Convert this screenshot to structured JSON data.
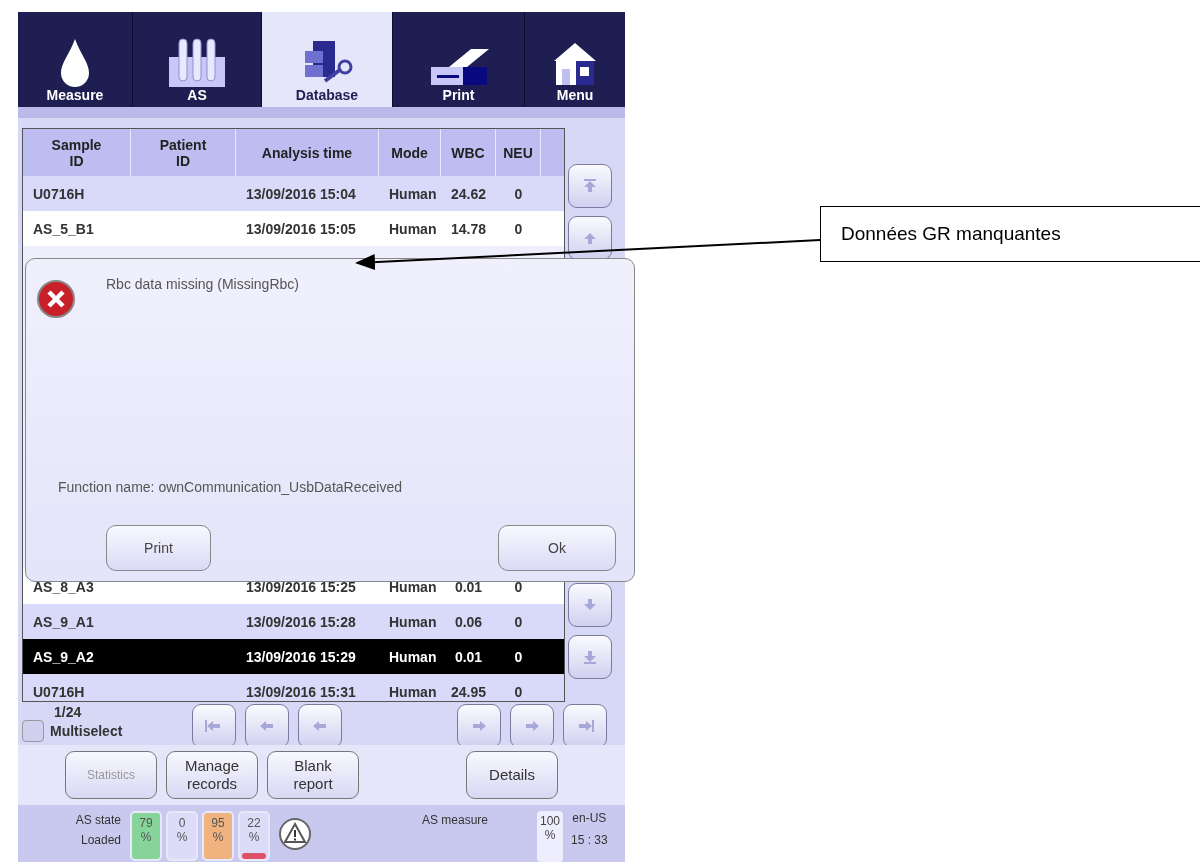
{
  "nav_tabs": [
    {
      "label": "Measure",
      "kind": "drop",
      "selected": false
    },
    {
      "label": "AS",
      "kind": "tubes",
      "selected": false
    },
    {
      "label": "Database",
      "kind": "database",
      "selected": true
    },
    {
      "label": "Print",
      "kind": "printer",
      "selected": false
    },
    {
      "label": "Menu",
      "kind": "home",
      "selected": false
    }
  ],
  "table": {
    "columns": [
      "Sample ID",
      "Patient ID",
      "Analysis time",
      "Mode",
      "WBC",
      "NEU"
    ],
    "rows_top": [
      {
        "cells": [
          "U0716H",
          "",
          "13/09/2016 15:04",
          "Human",
          "24.62",
          "0"
        ],
        "selected": false
      },
      {
        "cells": [
          "AS_5_B1",
          "",
          "13/09/2016 15:05",
          "Human",
          "14.78",
          "0"
        ],
        "selected": false
      }
    ],
    "rows_bottom": [
      {
        "cells": [
          "AS_8_A3",
          "",
          "13/09/2016 15:25",
          "Human",
          "0.01",
          "0"
        ],
        "selected": false
      },
      {
        "cells": [
          "AS_9_A1",
          "",
          "13/09/2016 15:28",
          "Human",
          "0.06",
          "0"
        ],
        "selected": false
      },
      {
        "cells": [
          "AS_9_A2",
          "",
          "13/09/2016 15:29",
          "Human",
          "0.01",
          "0"
        ],
        "selected": true
      },
      {
        "cells": [
          "U0716H",
          "",
          "13/09/2016 15:31",
          "Human",
          "24.95",
          "0"
        ],
        "selected": false
      }
    ]
  },
  "pager": {
    "page": "1/24",
    "multiselect": {
      "label": "Multiselect",
      "checked": false
    }
  },
  "actions": [
    {
      "label": "Statistics",
      "disabled": true
    },
    {
      "label": "Manage records",
      "disabled": false
    },
    {
      "label": "Blank report",
      "disabled": false
    },
    {
      "label": "Details",
      "disabled": false
    }
  ],
  "status_bar": {
    "state_label": "AS state",
    "state_value": "Loaded",
    "gauges": [
      {
        "value": "79",
        "unit": "%",
        "color": "#86d49a",
        "warning": false
      },
      {
        "value": "0",
        "unit": "%",
        "color": "#dcdcf8",
        "warning": false
      },
      {
        "value": "95",
        "unit": "%",
        "color": "#f0b27e",
        "warning": false
      },
      {
        "value": "22",
        "unit": "%",
        "color": "#dcdcf8",
        "warning": true
      }
    ],
    "mode": "AS measure",
    "zoom_value": "100",
    "zoom_unit": "%",
    "locale": "en-US",
    "time": "15 : 33"
  },
  "dialog": {
    "message": "Rbc data missing (MissingRbc)",
    "function": "Function name: ownCommunication_UsbDataReceived",
    "buttons": [
      "Print",
      "Ok"
    ]
  },
  "annotation": {
    "text": "Données GR manquantes"
  }
}
